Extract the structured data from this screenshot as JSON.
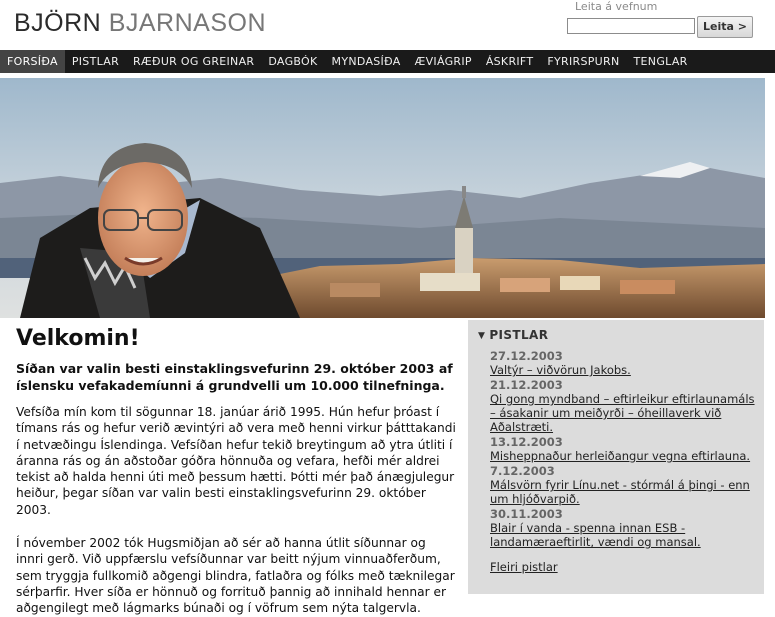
{
  "header": {
    "logo_first": "BJÖRN",
    "logo_last": "BJARNASON",
    "search_label": "Leita á vefnum",
    "search_value": "",
    "search_button": "Leita >"
  },
  "nav": {
    "items": [
      "FORSÍÐA",
      "PISTLAR",
      "RÆÐUR OG GREINAR",
      "DAGBÓK",
      "MYNDASÍÐA",
      "ÆVIÁGRIP",
      "ÁSKRIFT",
      "FYRIRSPURN",
      "TENGLAR"
    ]
  },
  "main": {
    "title": "Velkomin!",
    "lead": "Síðan var valin besti einstaklingsvefurinn 29. október 2003 af íslensku vefakademíunni á grundvelli um 10.000 tilnefninga.",
    "para1": "Vefsíða mín kom til sögunnar 18. janúar árið 1995. Hún hefur þróast í tímans rás og hefur verið ævintýri að vera með henni virkur þátttakandi í netvæðingu Íslendinga. Vefsíðan hefur tekið breytingum að ytra útliti í áranna rás og án aðstoðar góðra hönnuða og vefara, hefði mér aldrei tekist að halda henni úti með þessum hætti. Þótti mér það ánægjulegur heiður, þegar síðan var valin besti einstaklingsvefurinn 29. október 2003.",
    "para2": "Í nóvember 2002  tók Hugsmiðjan að sér að hanna útlit síðunnar og innri gerð. Við uppfærslu vefsíðunnar var beitt nýjum vinnuaðferðum, sem tryggja fullkomið aðgengi blindra, fatlaðra og fólks með tæknilegar sérþarfir. Hver síða er hönnuð og forrituð þannig að innihald hennar er aðgengilegt með lágmarks búnaði og í vöfrum sem nýta talgervla."
  },
  "sidebar": {
    "heading": "PISTLAR",
    "items": [
      {
        "date": "27.12.2003",
        "title": "Valtýr – viðvörun Jakobs."
      },
      {
        "date": "21.12.2003",
        "title": "Qi gong myndband – eftirleikur eftirlaunamáls – ásakanir um meiðyrði – óheillaverk við Aðalstræti."
      },
      {
        "date": "13.12.2003",
        "title": "Misheppnaður herleiðangur vegna eftirlauna."
      },
      {
        "date": "7.12.2003",
        "title": "Málsvörn fyrir Línu.net - stórmál á þingi - enn um hljóðvarpið."
      },
      {
        "date": "30.11.2003",
        "title": "Blair í vanda - spenna innan ESB - landamæraeftirlit, vændi og mansal."
      }
    ],
    "more": "Fleiri pistlar"
  }
}
